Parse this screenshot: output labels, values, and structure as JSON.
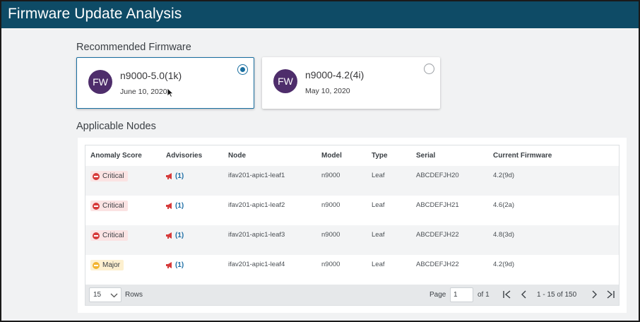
{
  "header": {
    "title": "Firmware Update Analysis"
  },
  "recommended": {
    "section_title": "Recommended Firmware",
    "cards": [
      {
        "avatar": "FW",
        "name": "n9000-5.0(1k)",
        "date": "June 10, 2020",
        "selected": true
      },
      {
        "avatar": "FW",
        "name": "n9000-4.2(4i)",
        "date": "May 10, 2020",
        "selected": false
      }
    ]
  },
  "nodes": {
    "section_title": "Applicable Nodes",
    "columns": [
      "Anomaly Score",
      "Advisories",
      "Node",
      "Model",
      "Type",
      "Serial",
      "Current Firmware"
    ],
    "rows": [
      {
        "score": "Critical",
        "severity": "critical",
        "advisories": "(1)",
        "node": "ifav201-apic1-leaf1",
        "model": "n9000",
        "type": "Leaf",
        "serial": "ABCDEFJH20",
        "firmware": "4.2(9d)"
      },
      {
        "score": "Critical",
        "severity": "critical",
        "advisories": "(1)",
        "node": "ifav201-apic1-leaf2",
        "model": "n9000",
        "type": "Leaf",
        "serial": "ABCDEFJH21",
        "firmware": "4.6(2a)"
      },
      {
        "score": "Critical",
        "severity": "critical",
        "advisories": "(1)",
        "node": "ifav201-apic1-leaf3",
        "model": "n9000",
        "type": "Leaf",
        "serial": "ABCDEFJH22",
        "firmware": "4.8(3d)"
      },
      {
        "score": "Major",
        "severity": "major",
        "advisories": "(1)",
        "node": "ifav201-apic1-leaf4",
        "model": "n9000",
        "type": "Leaf",
        "serial": "ABCDEFJH22",
        "firmware": "4.2(9d)"
      }
    ],
    "pagination": {
      "rows_per_page": "15",
      "rows_label": "Rows",
      "page_label": "Page",
      "page_value": "1",
      "of_label": "of 1",
      "range": "1 - 15 of 150"
    }
  },
  "colors": {
    "header_bg": "#0e4b66",
    "avatar_bg": "#4e2d6b",
    "accent": "#1a6fa0",
    "critical": "#d63a3a",
    "major": "#f2b430"
  },
  "icons": [
    "radio-selected-icon",
    "radio-unselected-icon",
    "critical-icon",
    "major-icon",
    "megaphone-icon",
    "chevron-down-icon",
    "first-page-icon",
    "prev-page-icon",
    "next-page-icon",
    "last-page-icon",
    "mouse-cursor-icon"
  ]
}
